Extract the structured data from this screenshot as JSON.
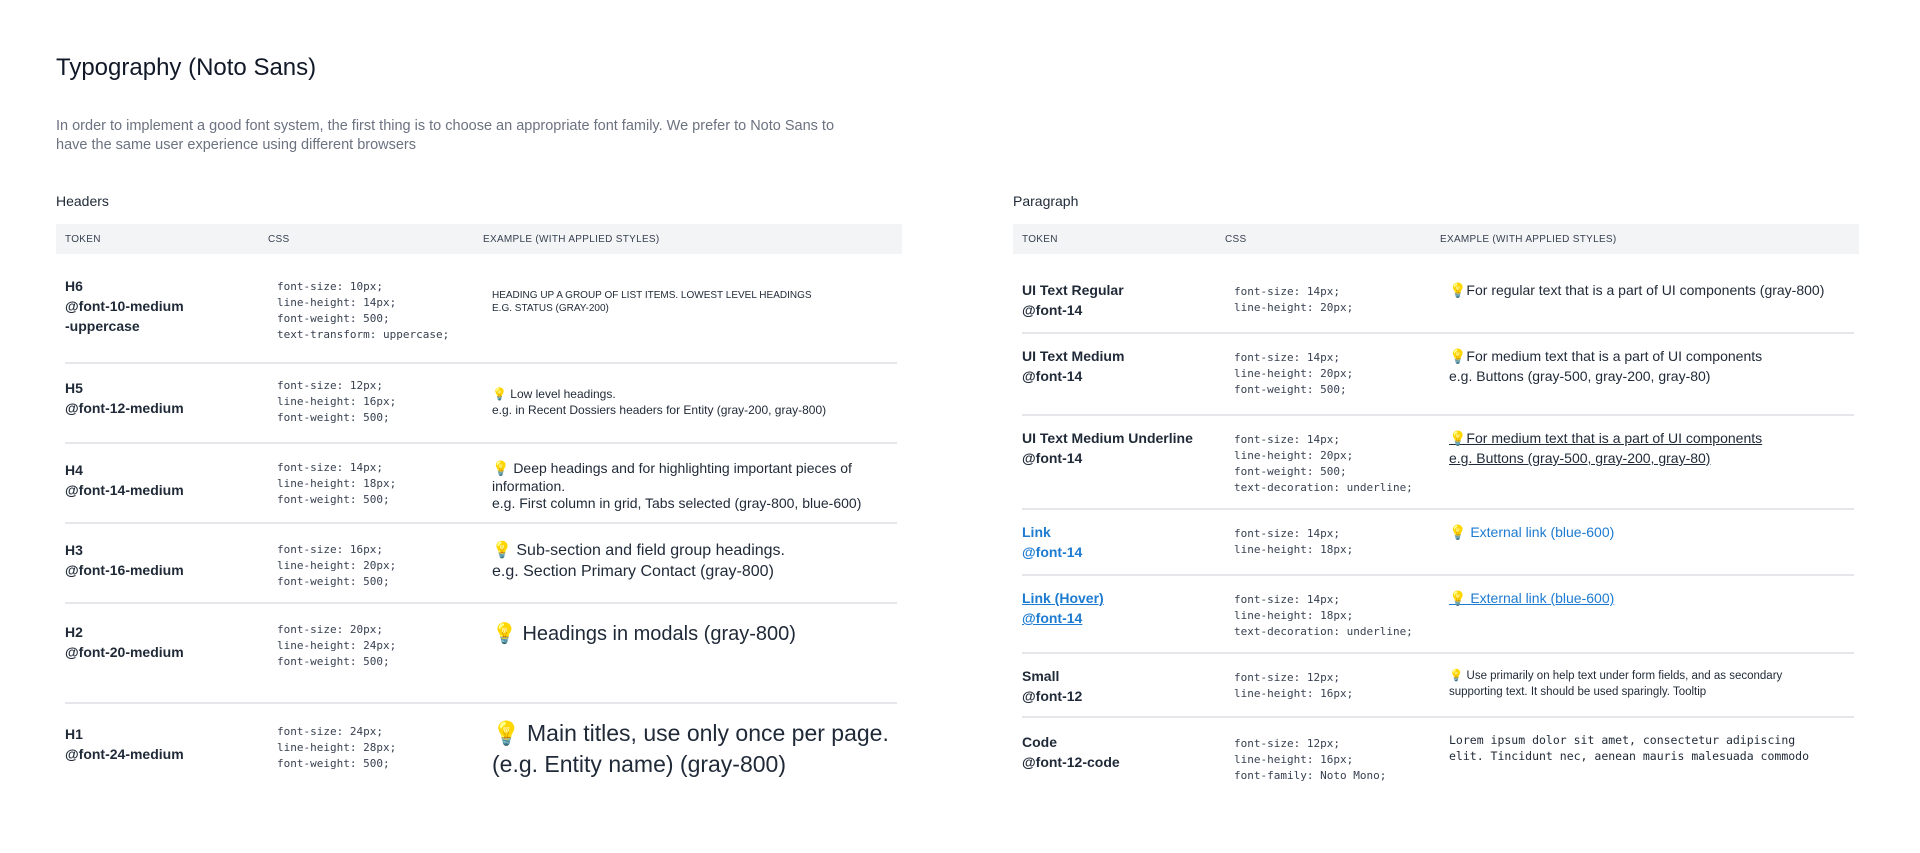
{
  "page": {
    "title": "Typography (Noto Sans)",
    "description": "In order to implement a good font system, the first thing is to choose an appropriate font family. We prefer to Noto Sans to have the same user experience using different browsers"
  },
  "columns": {
    "token": "TOKEN",
    "css": "CSS",
    "example": "EXAMPLE (WITH APPLIED STYLES)"
  },
  "headers": {
    "title": "Headers",
    "rows": [
      {
        "token": "H6\n@font-10-medium\n-uppercase",
        "css": "font-size: 10px;\nline-height: 14px;\nfont-weight: 500;\ntext-transform: uppercase;",
        "example": "HEADING UP A GROUP OF LIST ITEMS. LOWEST LEVEL HEADINGS\nE.G. STATUS (GRAY-200)"
      },
      {
        "token": "H5\n@font-12-medium",
        "css": "font-size: 12px;\nline-height: 16px;\nfont-weight: 500;",
        "example": "💡 Low level headings.\ne.g. in Recent Dossiers headers for Entity (gray-200, gray-800)"
      },
      {
        "token": "H4\n@font-14-medium",
        "css": "font-size: 14px;\nline-height: 18px;\nfont-weight: 500;",
        "example": "💡 Deep headings and for highlighting important pieces of information.\ne.g. First column in grid, Tabs selected (gray-800, blue-600)"
      },
      {
        "token": "H3\n@font-16-medium",
        "css": "font-size: 16px;\nline-height: 20px;\nfont-weight: 500;",
        "example": "💡 Sub-section and field group headings.\ne.g. Section Primary Contact (gray-800)"
      },
      {
        "token": "H2\n@font-20-medium",
        "css": "font-size: 20px;\nline-height: 24px;\nfont-weight: 500;",
        "example": "💡 Headings in modals (gray-800)"
      },
      {
        "token": "H1\n@font-24-medium",
        "css": "font-size: 24px;\nline-height: 28px;\nfont-weight: 500;",
        "example": "💡 Main titles, use only once per page.\n(e.g. Entity name) (gray-800)"
      }
    ]
  },
  "paragraph": {
    "title": "Paragraph",
    "rows": [
      {
        "token": "UI Text Regular\n@font-14",
        "css": "font-size: 14px;\nline-height: 20px;",
        "example": "💡For regular text that is a part of UI components (gray-800)"
      },
      {
        "token": "UI Text Medium\n@font-14",
        "css": "font-size: 14px;\nline-height: 20px;\nfont-weight: 500;",
        "example": "💡For medium text that is a part of UI components\ne.g. Buttons (gray-500, gray-200, gray-80)"
      },
      {
        "token": "UI Text Medium Underline\n@font-14",
        "css": "font-size: 14px;\nline-height: 20px;\nfont-weight: 500;\ntext-decoration: underline;",
        "example": "💡For medium text that is a part of UI components\ne.g. Buttons (gray-500, gray-200, gray-80)"
      },
      {
        "token": "Link\n@font-14",
        "css": "font-size: 14px;\nline-height: 18px;",
        "example": "💡 External link (blue-600)"
      },
      {
        "token": "Link (Hover)\n@font-14",
        "css": "font-size: 14px;\nline-height: 18px;\ntext-decoration: underline;",
        "example": "💡 External link (blue-600)"
      },
      {
        "token": "Small\n@font-12",
        "css": "font-size: 12px;\nline-height: 16px;",
        "example": "💡 Use primarily on help text under form fields, and as secondary supporting text. It should be used sparingly. Tooltip"
      },
      {
        "token": "Code\n@font-12-code",
        "css": "font-size: 12px;\nline-height: 16px;\nfont-family: Noto Mono;",
        "example": "Lorem ipsum dolor sit amet, consectetur adipiscing\nelit. Tincidunt nec, aenean mauris malesuada commodo"
      }
    ]
  },
  "colors": {
    "link": "#1d7bd1",
    "text": "#1f2937",
    "muted": "#6b7280",
    "header_bg": "#f3f4f6",
    "divider": "#e5e7eb"
  }
}
